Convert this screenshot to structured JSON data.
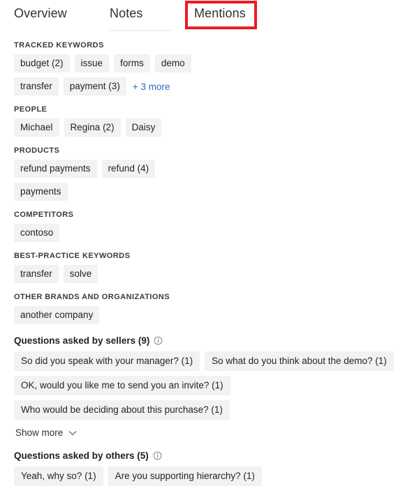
{
  "tabs": [
    {
      "label": "Overview",
      "selected": false
    },
    {
      "label": "Notes",
      "selected": false
    },
    {
      "label": "Mentions",
      "selected": true
    }
  ],
  "highlight_color": "#ed1c24",
  "link_color": "#2b67c9",
  "chip_background": "#f3f2f1",
  "sections": [
    {
      "title": "TRACKED KEYWORDS",
      "chips": [
        "budget (2)",
        "issue",
        "forms",
        "demo",
        "transfer",
        "payment (3)"
      ],
      "more_label": "+ 3 more"
    },
    {
      "title": "PEOPLE",
      "chips": [
        "Michael",
        "Regina (2)",
        "Daisy"
      ],
      "more_label": ""
    },
    {
      "title": "PRODUCTS",
      "chips": [
        "refund payments",
        "refund (4)",
        "payments"
      ],
      "more_label": ""
    },
    {
      "title": "COMPETITORS",
      "chips": [
        "contoso"
      ],
      "more_label": ""
    },
    {
      "title": "BEST-PRACTICE KEYWORDS",
      "chips": [
        "transfer",
        "solve"
      ],
      "more_label": ""
    },
    {
      "title": "OTHER BRANDS AND ORGANIZATIONS",
      "chips": [
        "another company"
      ],
      "more_label": ""
    }
  ],
  "questions_sellers": {
    "title": "Questions asked by sellers (9)",
    "info_icon": "info-circle-icon",
    "chips": [
      "So did you speak with your manager? (1)",
      "So what do you think about the demo? (1)",
      "OK, would you like me to send you an invite? (1)",
      "Who would be deciding about this purchase? (1)"
    ],
    "show_more_label": "Show more"
  },
  "questions_others": {
    "title": "Questions asked by others (5)",
    "info_icon": "info-circle-icon",
    "chips": [
      "Yeah, why so? (1)",
      "Are you supporting hierarchy? (1)"
    ]
  }
}
